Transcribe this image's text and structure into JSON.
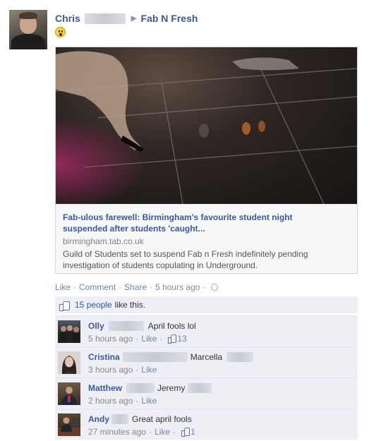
{
  "post": {
    "author_first": "Chris",
    "target_page": "Fab N Fresh",
    "arrow": "▶"
  },
  "link": {
    "title": "Fab-ulous farewell: Birmingham's favourite student night suspended after students 'caught...",
    "domain": "birmingham.tab.co.uk",
    "description": "Guild of Students set to suspend Fab n Fresh indefinitely pending investigation of students copulating in Underground."
  },
  "actions": {
    "like": "Like",
    "comment": "Comment",
    "share": "Share",
    "timestamp": "5 hours ago",
    "separator": "·"
  },
  "likes": {
    "count": "15 people",
    "suffix": "like this."
  },
  "comments": [
    {
      "name": "Olly",
      "text": "April fools lol",
      "time": "5 hours ago",
      "like": "Like",
      "likes": "13"
    },
    {
      "name": "Cristina",
      "text": "Marcella",
      "time": "3 hours ago",
      "like": "Like",
      "likes": ""
    },
    {
      "name": "Matthew",
      "text": "Jeremy",
      "time": "2 hours ago",
      "like": "Like",
      "likes": ""
    },
    {
      "name": "Andy",
      "text": "Great april fools",
      "time": "27 minutes ago",
      "like": "Like",
      "likes": "1"
    }
  ],
  "colors": {
    "link_blue": "#3b5998",
    "light_blue": "#6d84b4",
    "comment_bg": "#edeff4",
    "card_bg": "#f6f7f9"
  }
}
